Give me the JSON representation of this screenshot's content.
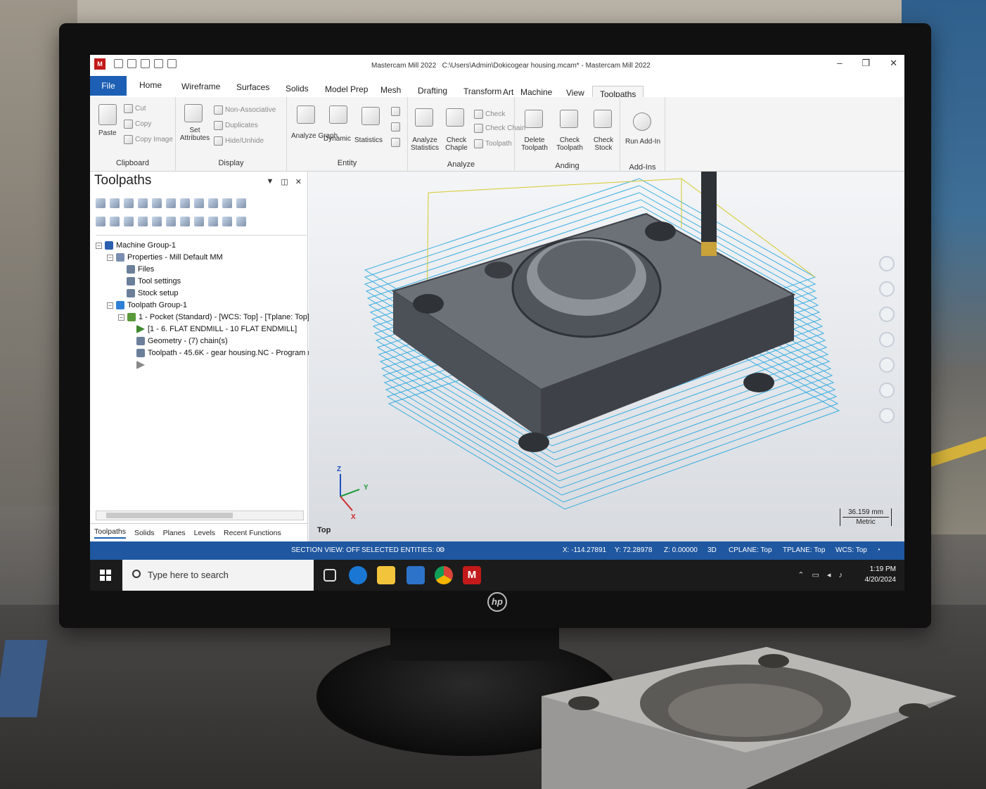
{
  "window": {
    "title": "Mastercam Mill 2022",
    "path": "C:\\Users\\Admin\\Dokicogear housing.mcam* - Mastercam Mill 2022",
    "controls": [
      "–",
      "❐",
      "✕"
    ]
  },
  "tabs": [
    {
      "label": "File"
    },
    {
      "label": "Home"
    },
    {
      "label": "Wireframe"
    },
    {
      "label": "Surfaces"
    },
    {
      "label": "Solids"
    },
    {
      "label": "Model Prep"
    },
    {
      "label": "Mesh"
    },
    {
      "label": "Drafting"
    },
    {
      "label": "Transform"
    },
    {
      "label": "Art"
    },
    {
      "label": "Machine"
    },
    {
      "label": "View"
    },
    {
      "label": "Toolpaths"
    }
  ],
  "ribbon": {
    "clipboard": {
      "label": "Clipboard",
      "paste": "Paste",
      "cut": "Cut",
      "copy": "Copy",
      "copy_image": "Copy Image"
    },
    "display": {
      "label": "Display",
      "attributes": "Set Attributes",
      "non_associative": "Non-Associative",
      "duplicates": "Duplicates",
      "hide_unhide": "Hide/Unhide"
    },
    "entity": {
      "label": "Entity",
      "analyze": "Analyze Graph",
      "dynamic": "Dynamic",
      "statistics": "Statistics"
    },
    "analyze": {
      "label": "Analyze",
      "stats": "Analyze Statistics",
      "check": "Check Chaple",
      "check_chain": "Check Chain",
      "toolpath": "Toolpath",
      "check_tool": "Check",
      "check_toolpath_small": "Check Toolpath"
    },
    "anding": {
      "label": "Anding",
      "delete_toolpath": "Delete Toolpath",
      "check_toolpath": "Check Toolpath",
      "check_stock": "Check Stock"
    },
    "addins": {
      "label": "Add-Ins",
      "run": "Run Add-In"
    }
  },
  "panel": {
    "title": "Toolpaths",
    "tree": [
      {
        "label": "Machine Group-1"
      },
      {
        "label": "Properties - Mill Default MM"
      },
      {
        "label": "Files"
      },
      {
        "label": "Tool settings"
      },
      {
        "label": "Stock setup"
      },
      {
        "label": "Toolpath Group-1"
      },
      {
        "label": "1 - Pocket (Standard) - [WCS: Top] - [Tplane: Top]"
      },
      {
        "label": "[1 - 6. FLAT ENDMILL - 10 FLAT ENDMILL]"
      },
      {
        "label": "Geometry - (7) chain(s)"
      },
      {
        "label": "Toolpath - 45.6K - gear housing.NC - Program n"
      }
    ],
    "tabs": [
      "Toolpaths",
      "Solids",
      "Planes",
      "Levels",
      "Recent Functions"
    ]
  },
  "viewport": {
    "view_name": "Top",
    "axes": {
      "z": "Z",
      "y": "Y",
      "x": "X"
    },
    "scale_value": "36.159 mm",
    "scale_unit": "Metric"
  },
  "status": {
    "section": "SECTION VIEW: OFF",
    "selected": "SELECTED ENTITIES: 0",
    "x": "X: -114.27891",
    "y": "Y: 72.28978",
    "z": "Z: 0.00000",
    "mode": "3D",
    "cplane": "CPLANE: Top",
    "tplane": "TPLANE: Top",
    "wcs": "WCS: Top"
  },
  "taskbar": {
    "search_placeholder": "Type here to search",
    "time": "1:19 PM",
    "date": "4/20/2024"
  },
  "colors": {
    "accent": "#1d5fb4",
    "toolpath": "#1aa3e0",
    "statusbar": "#1f57a0"
  }
}
